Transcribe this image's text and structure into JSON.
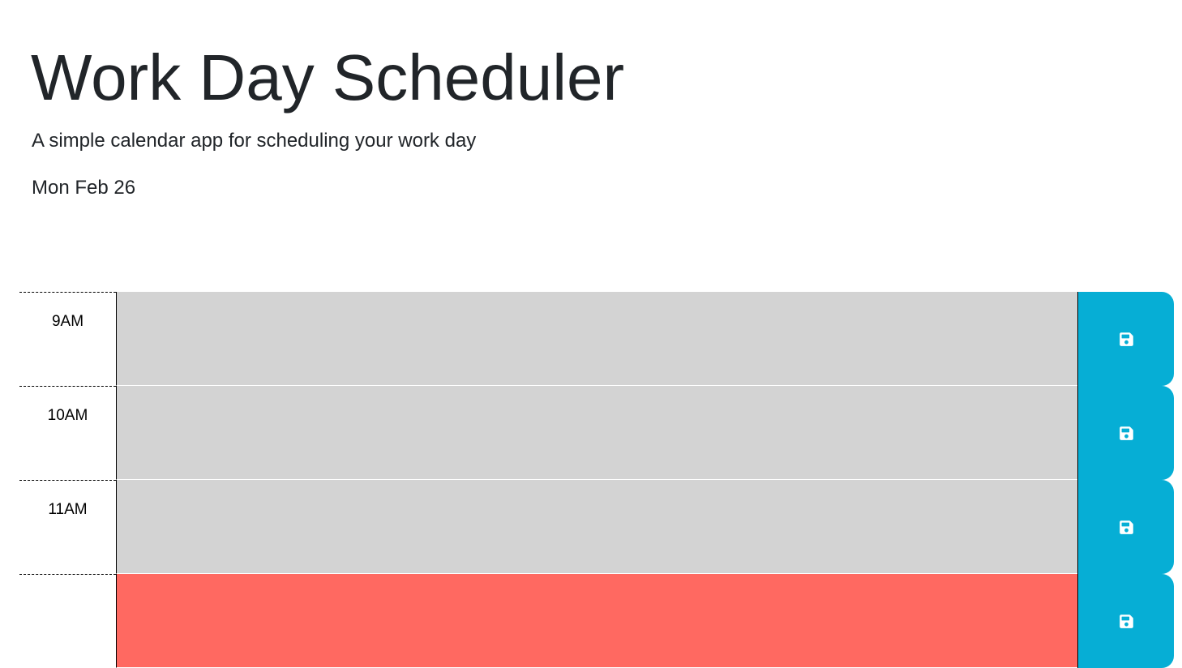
{
  "header": {
    "title": "Work Day Scheduler",
    "lead": "A simple calendar app for scheduling your work day",
    "current_day": "Mon Feb 26"
  },
  "colors": {
    "past": "#d3d3d3",
    "present": "#ff6961",
    "future": "#77dd77",
    "save_button": "#06aed5",
    "save_icon": "#ffffff"
  },
  "time_blocks": [
    {
      "hour": "9AM",
      "status": "past",
      "text": "",
      "save_icon": "floppy-disk-icon"
    },
    {
      "hour": "10AM",
      "status": "past",
      "text": "",
      "save_icon": "floppy-disk-icon"
    },
    {
      "hour": "11AM",
      "status": "past",
      "text": "",
      "save_icon": "floppy-disk-icon"
    },
    {
      "hour": "",
      "status": "present",
      "text": "",
      "save_icon": "floppy-disk-icon"
    }
  ]
}
